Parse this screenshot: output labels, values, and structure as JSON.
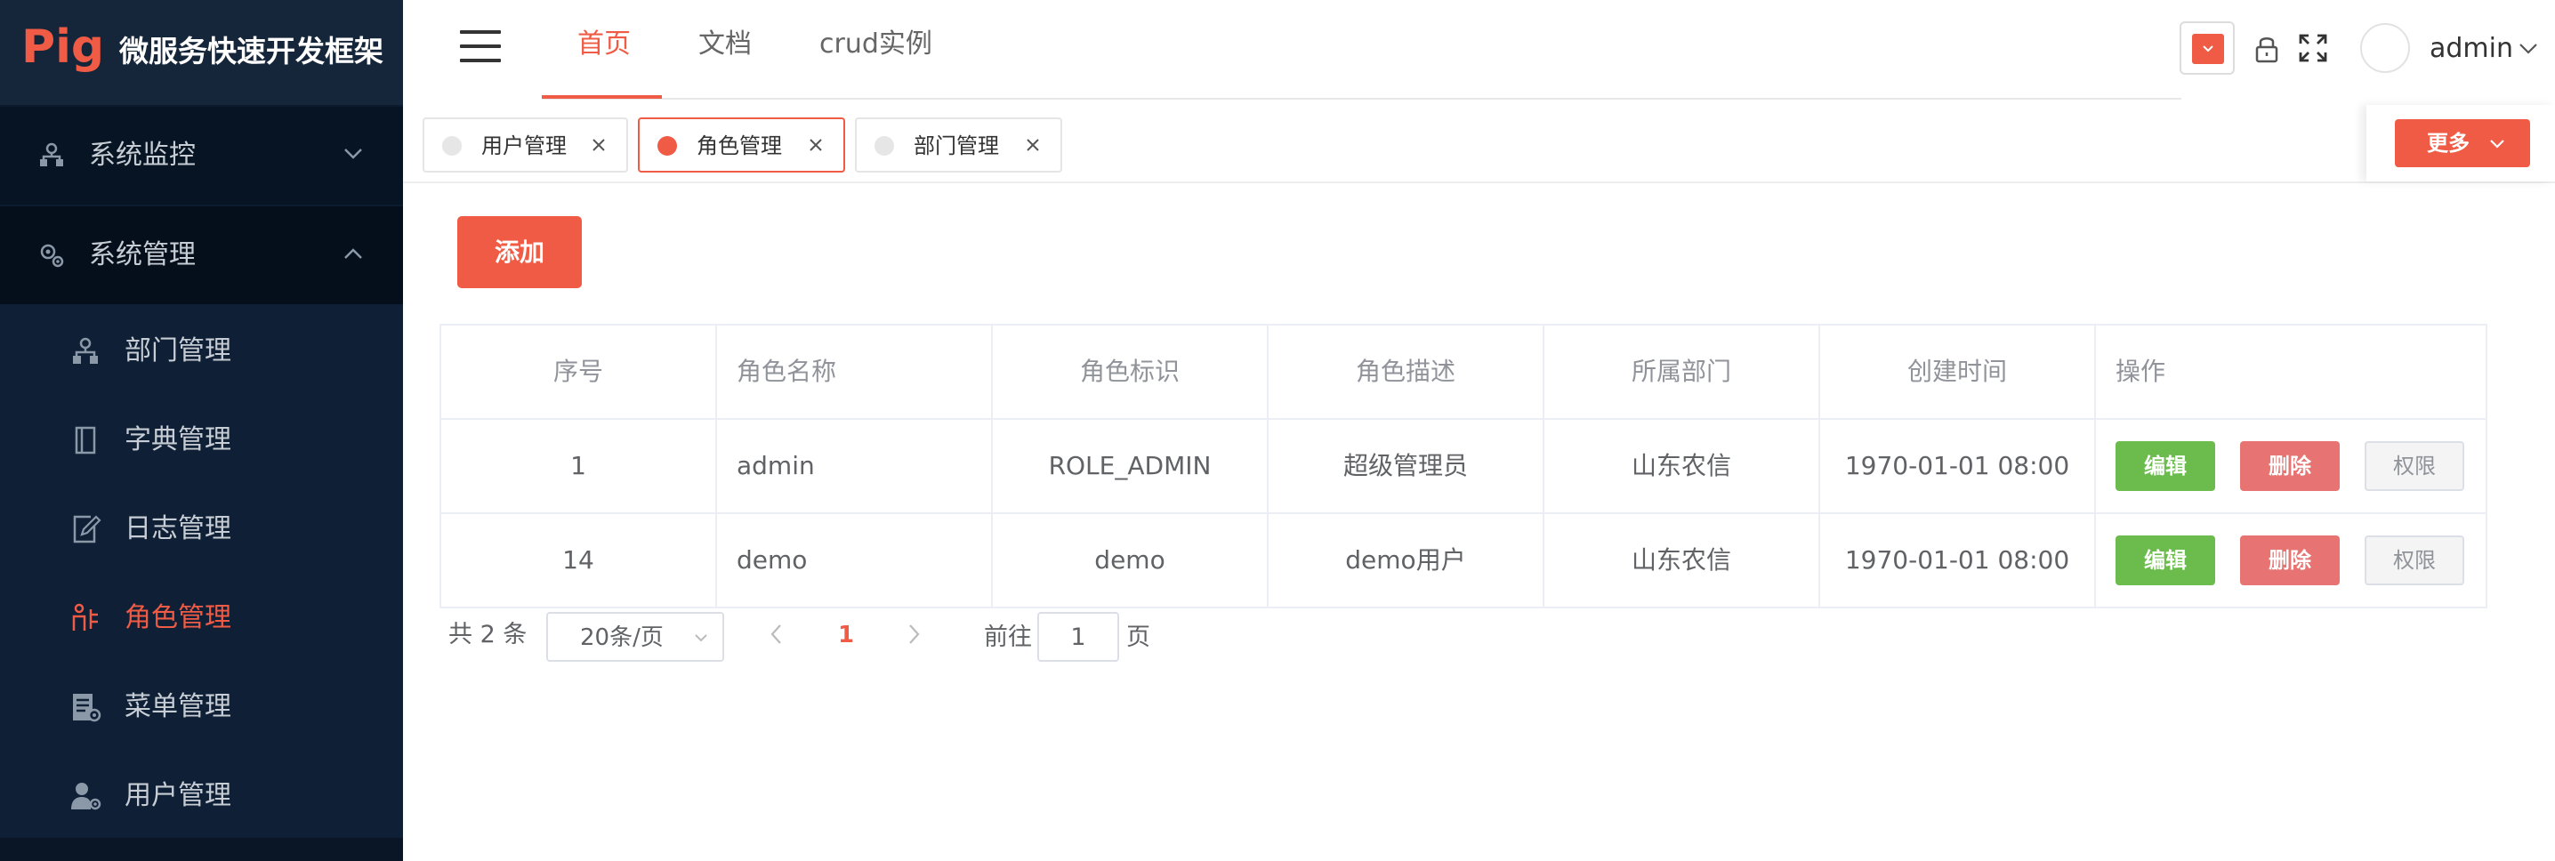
{
  "brand": {
    "logo": "Pig",
    "title": "微服务快速开发框架"
  },
  "sidebar": {
    "groups": [
      {
        "label": "系统监控",
        "icon": "monitor-icon",
        "expanded": false
      },
      {
        "label": "系统管理",
        "icon": "settings-icon",
        "expanded": true
      }
    ],
    "items": [
      {
        "label": "部门管理",
        "icon": "department-icon"
      },
      {
        "label": "字典管理",
        "icon": "dictionary-icon"
      },
      {
        "label": "日志管理",
        "icon": "log-icon"
      },
      {
        "label": "角色管理",
        "icon": "role-icon",
        "active": true
      },
      {
        "label": "菜单管理",
        "icon": "menu-icon"
      },
      {
        "label": "用户管理",
        "icon": "user-icon"
      }
    ]
  },
  "header": {
    "tabs": [
      {
        "label": "首页",
        "active": true
      },
      {
        "label": "文档"
      },
      {
        "label": "crud实例"
      }
    ],
    "username": "admin",
    "theme_color": "#ef5b45"
  },
  "tags": {
    "items": [
      {
        "label": "用户管理"
      },
      {
        "label": "角色管理",
        "active": true
      },
      {
        "label": "部门管理"
      }
    ],
    "more_label": "更多"
  },
  "main": {
    "add_label": "添加",
    "table": {
      "columns": [
        "序号",
        "角色名称",
        "角色标识",
        "角色描述",
        "所属部门",
        "创建时间",
        "操作"
      ],
      "rows": [
        [
          "1",
          "admin",
          "ROLE_ADMIN",
          "超级管理员",
          "山东农信",
          "1970-01-01 08:00"
        ],
        [
          "14",
          "demo",
          "demo",
          "demo用户",
          "山东农信",
          "1970-01-01 08:00"
        ]
      ],
      "actions": {
        "edit": "编辑",
        "delete": "删除",
        "permission": "权限"
      }
    },
    "pagination": {
      "total": "共 2 条",
      "page_size": "20条/页",
      "current_page": "1",
      "goto_label": "前往",
      "goto_value": "1",
      "page_unit": "页"
    }
  },
  "colors": {
    "accent": "#ef5b45",
    "sidebar_bg": "#0d1b2e",
    "edit": "#6cbb4d",
    "delete": "#e77472"
  }
}
